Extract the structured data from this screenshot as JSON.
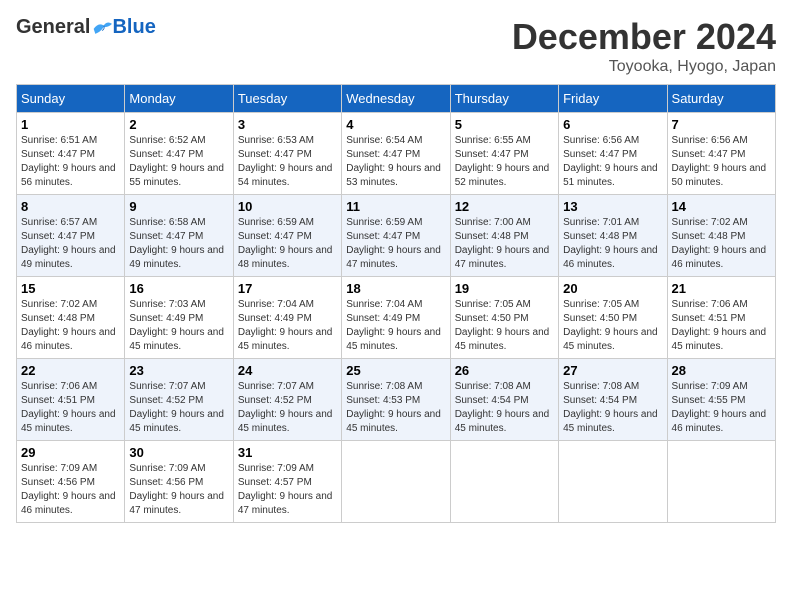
{
  "logo": {
    "general": "General",
    "blue": "Blue"
  },
  "header": {
    "month_year": "December 2024",
    "location": "Toyooka, Hyogo, Japan"
  },
  "weekdays": [
    "Sunday",
    "Monday",
    "Tuesday",
    "Wednesday",
    "Thursday",
    "Friday",
    "Saturday"
  ],
  "weeks": [
    [
      {
        "day": "1",
        "sunrise": "6:51 AM",
        "sunset": "4:47 PM",
        "daylight": "9 hours and 56 minutes."
      },
      {
        "day": "2",
        "sunrise": "6:52 AM",
        "sunset": "4:47 PM",
        "daylight": "9 hours and 55 minutes."
      },
      {
        "day": "3",
        "sunrise": "6:53 AM",
        "sunset": "4:47 PM",
        "daylight": "9 hours and 54 minutes."
      },
      {
        "day": "4",
        "sunrise": "6:54 AM",
        "sunset": "4:47 PM",
        "daylight": "9 hours and 53 minutes."
      },
      {
        "day": "5",
        "sunrise": "6:55 AM",
        "sunset": "4:47 PM",
        "daylight": "9 hours and 52 minutes."
      },
      {
        "day": "6",
        "sunrise": "6:56 AM",
        "sunset": "4:47 PM",
        "daylight": "9 hours and 51 minutes."
      },
      {
        "day": "7",
        "sunrise": "6:56 AM",
        "sunset": "4:47 PM",
        "daylight": "9 hours and 50 minutes."
      }
    ],
    [
      {
        "day": "8",
        "sunrise": "6:57 AM",
        "sunset": "4:47 PM",
        "daylight": "9 hours and 49 minutes."
      },
      {
        "day": "9",
        "sunrise": "6:58 AM",
        "sunset": "4:47 PM",
        "daylight": "9 hours and 49 minutes."
      },
      {
        "day": "10",
        "sunrise": "6:59 AM",
        "sunset": "4:47 PM",
        "daylight": "9 hours and 48 minutes."
      },
      {
        "day": "11",
        "sunrise": "6:59 AM",
        "sunset": "4:47 PM",
        "daylight": "9 hours and 47 minutes."
      },
      {
        "day": "12",
        "sunrise": "7:00 AM",
        "sunset": "4:48 PM",
        "daylight": "9 hours and 47 minutes."
      },
      {
        "day": "13",
        "sunrise": "7:01 AM",
        "sunset": "4:48 PM",
        "daylight": "9 hours and 46 minutes."
      },
      {
        "day": "14",
        "sunrise": "7:02 AM",
        "sunset": "4:48 PM",
        "daylight": "9 hours and 46 minutes."
      }
    ],
    [
      {
        "day": "15",
        "sunrise": "7:02 AM",
        "sunset": "4:48 PM",
        "daylight": "9 hours and 46 minutes."
      },
      {
        "day": "16",
        "sunrise": "7:03 AM",
        "sunset": "4:49 PM",
        "daylight": "9 hours and 45 minutes."
      },
      {
        "day": "17",
        "sunrise": "7:04 AM",
        "sunset": "4:49 PM",
        "daylight": "9 hours and 45 minutes."
      },
      {
        "day": "18",
        "sunrise": "7:04 AM",
        "sunset": "4:49 PM",
        "daylight": "9 hours and 45 minutes."
      },
      {
        "day": "19",
        "sunrise": "7:05 AM",
        "sunset": "4:50 PM",
        "daylight": "9 hours and 45 minutes."
      },
      {
        "day": "20",
        "sunrise": "7:05 AM",
        "sunset": "4:50 PM",
        "daylight": "9 hours and 45 minutes."
      },
      {
        "day": "21",
        "sunrise": "7:06 AM",
        "sunset": "4:51 PM",
        "daylight": "9 hours and 45 minutes."
      }
    ],
    [
      {
        "day": "22",
        "sunrise": "7:06 AM",
        "sunset": "4:51 PM",
        "daylight": "9 hours and 45 minutes."
      },
      {
        "day": "23",
        "sunrise": "7:07 AM",
        "sunset": "4:52 PM",
        "daylight": "9 hours and 45 minutes."
      },
      {
        "day": "24",
        "sunrise": "7:07 AM",
        "sunset": "4:52 PM",
        "daylight": "9 hours and 45 minutes."
      },
      {
        "day": "25",
        "sunrise": "7:08 AM",
        "sunset": "4:53 PM",
        "daylight": "9 hours and 45 minutes."
      },
      {
        "day": "26",
        "sunrise": "7:08 AM",
        "sunset": "4:54 PM",
        "daylight": "9 hours and 45 minutes."
      },
      {
        "day": "27",
        "sunrise": "7:08 AM",
        "sunset": "4:54 PM",
        "daylight": "9 hours and 45 minutes."
      },
      {
        "day": "28",
        "sunrise": "7:09 AM",
        "sunset": "4:55 PM",
        "daylight": "9 hours and 46 minutes."
      }
    ],
    [
      {
        "day": "29",
        "sunrise": "7:09 AM",
        "sunset": "4:56 PM",
        "daylight": "9 hours and 46 minutes."
      },
      {
        "day": "30",
        "sunrise": "7:09 AM",
        "sunset": "4:56 PM",
        "daylight": "9 hours and 47 minutes."
      },
      {
        "day": "31",
        "sunrise": "7:09 AM",
        "sunset": "4:57 PM",
        "daylight": "9 hours and 47 minutes."
      },
      null,
      null,
      null,
      null
    ]
  ],
  "labels": {
    "sunrise": "Sunrise:",
    "sunset": "Sunset:",
    "daylight": "Daylight:"
  }
}
